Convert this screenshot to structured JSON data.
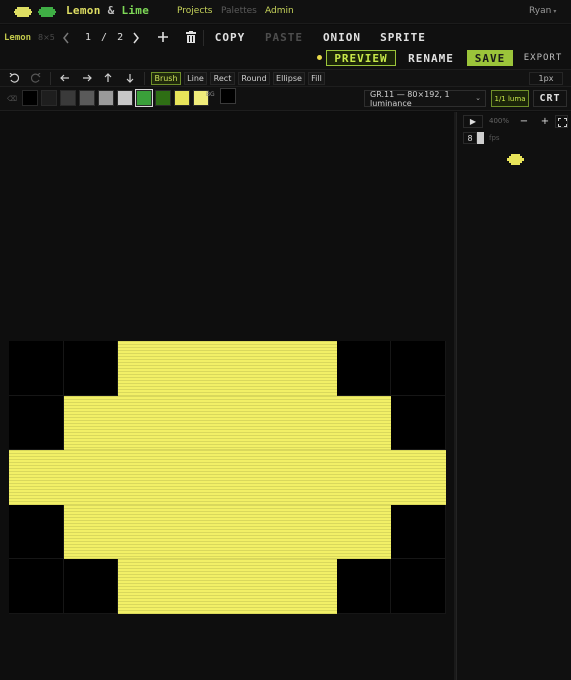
{
  "app": {
    "brand_lemon": "Lemon",
    "brand_amp": "&",
    "brand_lime": "Lime",
    "nav": [
      "Projects",
      "Palettes",
      "Admin"
    ],
    "user": "Ryan",
    "user_caret": "▾"
  },
  "project": {
    "name": "Lemon",
    "size": "8×5",
    "frame_counter": "1 / 2",
    "buttons": {
      "copy": "COPY",
      "paste": "PASTE",
      "onion": "ONION",
      "sprite": "SPRITE",
      "preview": "PREVIEW",
      "rename": "RENAME",
      "save": "SAVE",
      "export": "EXPORT"
    },
    "unsaved": true
  },
  "toolbar": {
    "tools": [
      "Brush",
      "Line",
      "Rect",
      "Round",
      "Ellipse",
      "Fill"
    ],
    "active_tool": "Brush",
    "brush_size": "1px"
  },
  "palette": {
    "eraser_label": "⌫",
    "swatches": [
      "#000000",
      "#1e1e1e",
      "#3a3a3a",
      "#5a5a5a",
      "#9a9a9a",
      "#c8c8c8",
      "#3aa03a",
      "#2e6e14",
      "#e8e45a",
      "#f0ec7a"
    ],
    "selected_index": 6,
    "bg_label": "BG",
    "bg_color": "#000000",
    "mode": "GR.11 — 80×192, 1 luminance",
    "mode_caret": "⌄",
    "luma_toggle": "1/1 luma",
    "crt_toggle": "CRT"
  },
  "canvas": {
    "cols": 8,
    "rows": 5,
    "on_color": "#f2f067",
    "pixels": [
      [
        0,
        0,
        1,
        1,
        1,
        1,
        0,
        0
      ],
      [
        0,
        1,
        1,
        1,
        1,
        1,
        1,
        0
      ],
      [
        1,
        1,
        1,
        1,
        1,
        1,
        1,
        1
      ],
      [
        0,
        1,
        1,
        1,
        1,
        1,
        1,
        0
      ],
      [
        0,
        0,
        1,
        1,
        1,
        1,
        0,
        0
      ]
    ]
  },
  "preview_panel": {
    "play": "▶",
    "zoom": "400%",
    "zoom_out": "−",
    "zoom_in": "+",
    "fps_value": "8",
    "fps_label": "fps"
  }
}
